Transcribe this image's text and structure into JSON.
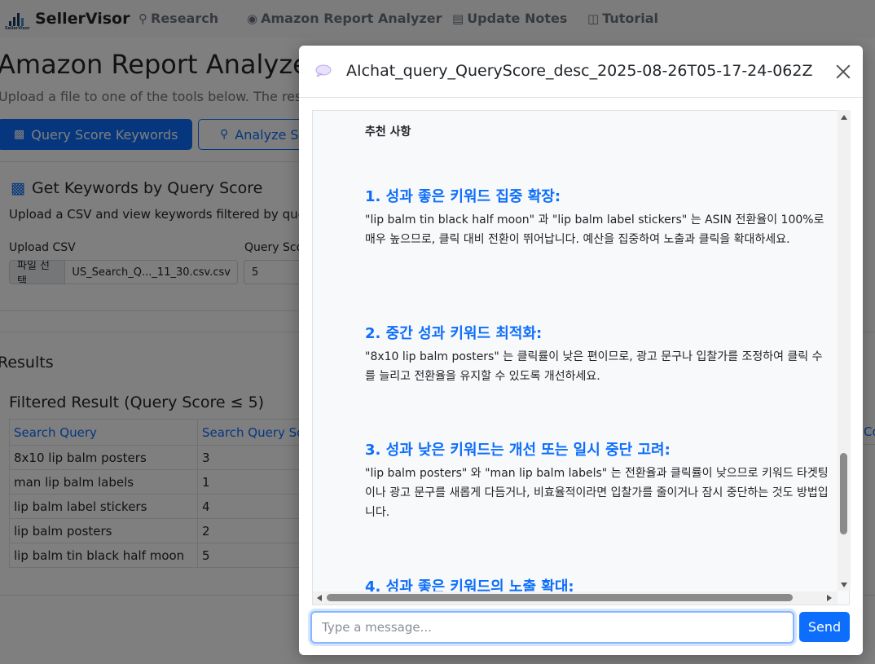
{
  "navbar": {
    "brand": "SellerVisor",
    "brand_small": "SellerVisor",
    "items": [
      {
        "label": "Research"
      },
      {
        "label": "Amazon Report Analyzer"
      },
      {
        "label": "Update Notes"
      },
      {
        "label": "Tutorial"
      }
    ]
  },
  "page": {
    "title": "Amazon Report Analyzer",
    "subtitle": "Upload a file to one of the tools below. The result w",
    "tools": [
      {
        "label": "Query Score Keywords"
      },
      {
        "label": "Analyze S"
      }
    ],
    "card": {
      "title": "Get Keywords by Query Score",
      "description": "Upload a CSV and view keywords filtered by que",
      "upload_label": "Upload CSV",
      "file_button": "파일 선택",
      "file_name": "US_Search_Q..._11_30.csv.csv",
      "query_score_label": "Query Sco",
      "query_score_value": "5"
    },
    "results_heading": "Results",
    "filtered_heading": "Filtered Result (Query Score ≤ 5)",
    "table": {
      "headers": [
        "Search Query",
        "Search Query Sco"
      ],
      "edge_header": "Co",
      "rows": [
        [
          "8x10 lip balm posters",
          "3"
        ],
        [
          "man lip balm labels",
          "1"
        ],
        [
          "lip balm label stickers",
          "4"
        ],
        [
          "lip balm posters",
          "2"
        ],
        [
          "lip balm tin black half moon",
          "5"
        ]
      ]
    }
  },
  "modal": {
    "title": "AIchat_query_QueryScore_desc_2025-08-26T05-17-24-062Z",
    "section_heading": "추천 사항",
    "recommendations": [
      {
        "title": "1. 성과 좋은 키워드 집중 확장:",
        "body": "\"lip balm tin black half moon\" 과 \"lip balm label stickers\" 는 ASIN 전환율이 100%로 매우 높으므로, 클릭 대비 전환이 뛰어납니다. 예산을 집중하여 노출과 클릭을 확대하세요."
      },
      {
        "title": "2. 중간 성과 키워드 최적화:",
        "body": "\"8x10 lip balm posters\" 는 클릭률이 낮은 편이므로, 광고 문구나 입찰가를 조정하여 클릭 수를 늘리고 전환율을 유지할 수 있도록 개선하세요."
      },
      {
        "title": "3. 성과 낮은 키워드는 개선 또는 일시 중단 고려:",
        "body": "\"lip balm posters\" 와 \"man lip balm labels\" 는 전환율과 클릭률이 낮으므로 키워드 타겟팅이나 광고 문구를 새롭게 다듬거나, 비효율적이라면 입찰가를 줄이거나 잠시 중단하는 것도 방법입니다."
      },
      {
        "title": "4. 성과 좋은 키워드의 노출 확대:",
        "body": ""
      }
    ],
    "input_placeholder": "Type a message...",
    "send_label": "Send"
  }
}
